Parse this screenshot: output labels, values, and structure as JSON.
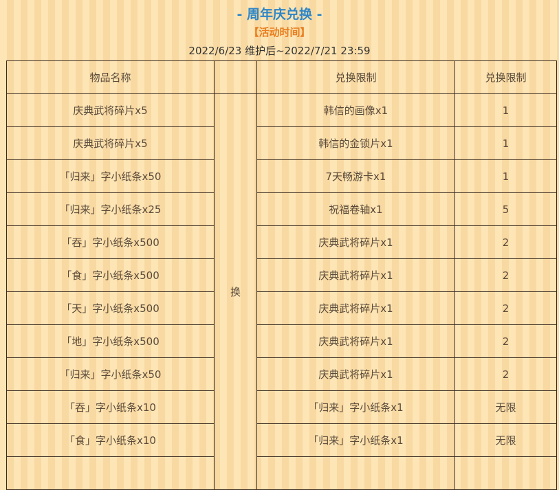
{
  "header": {
    "title": "- 周年庆兑换 -",
    "subtitle": "【活动时间】",
    "period": "2022/6/23 维护后~2022/7/21 23:59"
  },
  "table": {
    "columns": [
      "物品名称",
      "",
      "兑换限制",
      "兑换限制"
    ],
    "exchange_label": "换",
    "rows": [
      {
        "item": "庆典武将碎片x5",
        "reward": "韩信的画像x1",
        "limit": "1"
      },
      {
        "item": "庆典武将碎片x5",
        "reward": "韩信的金锁片x1",
        "limit": "1"
      },
      {
        "item": "「归来」字小纸条x50",
        "reward": "7天畅游卡x1",
        "limit": "1"
      },
      {
        "item": "「归来」字小纸条x25",
        "reward": "祝福卷轴x1",
        "limit": "5"
      },
      {
        "item": "「吞」字小纸条x500",
        "reward": "庆典武将碎片x1",
        "limit": "2"
      },
      {
        "item": "「食」字小纸条x500",
        "reward": "庆典武将碎片x1",
        "limit": "2"
      },
      {
        "item": "「天」字小纸条x500",
        "reward": "庆典武将碎片x1",
        "limit": "2"
      },
      {
        "item": "「地」字小纸条x500",
        "reward": "庆典武将碎片x1",
        "limit": "2"
      },
      {
        "item": "「归来」字小纸条x50",
        "reward": "庆典武将碎片x1",
        "limit": "2"
      },
      {
        "item": "「吞」字小纸条x10",
        "reward": "「归来」字小纸条x1",
        "limit": "无限"
      },
      {
        "item": "「食」字小纸条x10",
        "reward": "「归来」字小纸条x1",
        "limit": "无限"
      },
      {
        "item": "",
        "reward": "",
        "limit": ""
      }
    ]
  }
}
